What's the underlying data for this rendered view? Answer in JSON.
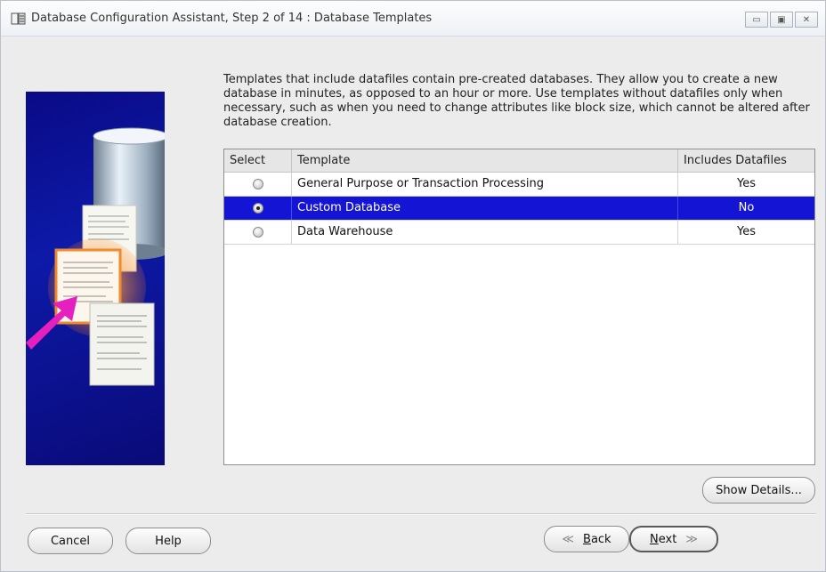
{
  "window": {
    "title": "Database Configuration Assistant, Step 2 of 14 : Database Templates",
    "minimize_glyph": "▭",
    "maximize_glyph": "▣",
    "close_glyph": "✕"
  },
  "description": "Templates that include datafiles contain pre-created databases. They allow you to create a new database in minutes, as opposed to an hour or more. Use templates without datafiles only when necessary, such as when you need to change attributes like block size, which cannot be altered after database creation.",
  "table": {
    "headers": [
      "Select",
      "Template",
      "Includes Datafiles"
    ],
    "rows": [
      {
        "selected": false,
        "template": "General Purpose or Transaction Processing",
        "includes_datafiles": "Yes"
      },
      {
        "selected": true,
        "template": "Custom Database",
        "includes_datafiles": "No"
      },
      {
        "selected": false,
        "template": "Data Warehouse",
        "includes_datafiles": "Yes"
      }
    ]
  },
  "buttons": {
    "show_details": "Show Details...",
    "cancel": "Cancel",
    "help": "Help",
    "back_glyph": "≪",
    "back_mnemonic": "B",
    "back_rest": "ack",
    "next_mnemonic": "N",
    "next_rest": "ext",
    "next_glyph": "≫"
  },
  "colors": {
    "selection": "#1414d4",
    "illustration_bg": "#0a0a86",
    "arrow": "#e61fbf"
  }
}
